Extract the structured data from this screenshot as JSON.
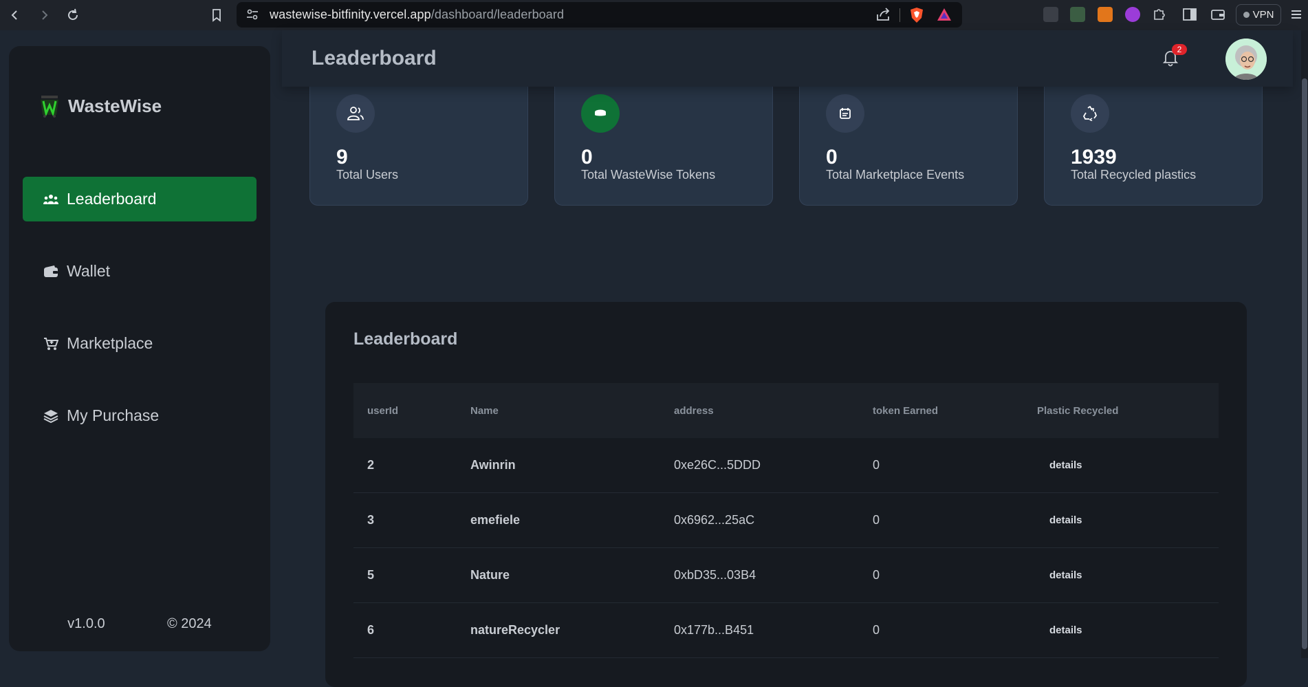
{
  "browser": {
    "url_host": "wastewise-bitfinity.vercel.app",
    "url_path": "/dashboard/leaderboard",
    "vpn_label": "VPN"
  },
  "app": {
    "brand_name": "WasteWise",
    "page_title": "Leaderboard",
    "notification_count": "2",
    "sidebar": {
      "items": [
        {
          "label": "Leaderboard",
          "icon": "users-icon",
          "active": true
        },
        {
          "label": "Wallet",
          "icon": "wallet-icon",
          "active": false
        },
        {
          "label": "Marketplace",
          "icon": "cart-icon",
          "active": false
        },
        {
          "label": "My Purchase",
          "icon": "layers-icon",
          "active": false
        }
      ],
      "version": "v1.0.0",
      "copyright": "© 2024"
    },
    "stats": [
      {
        "value": "9",
        "label": "Total Users",
        "icon": "users-outline-icon"
      },
      {
        "value": "0",
        "label": "Total WasteWise Tokens",
        "icon": "coins-icon"
      },
      {
        "value": "0",
        "label": "Total Marketplace Events",
        "icon": "calendar-icon"
      },
      {
        "value": "1939",
        "label": "Total Recycled plastics",
        "icon": "recycle-icon"
      }
    ],
    "leaderboard": {
      "title": "Leaderboard",
      "columns": [
        "userId",
        "Name",
        "address",
        "token Earned",
        "Plastic Recycled"
      ],
      "rows": [
        {
          "userId": "2",
          "name": "Awinrin",
          "address": "0xe26C...5DDD",
          "tokens": "0",
          "action": "details"
        },
        {
          "userId": "3",
          "name": "emefiele",
          "address": "0x6962...25aC",
          "tokens": "0",
          "action": "details"
        },
        {
          "userId": "5",
          "name": "Nature",
          "address": "0xbD35...03B4",
          "tokens": "0",
          "action": "details"
        },
        {
          "userId": "6",
          "name": "natureRecycler",
          "address": "0x177b...B451",
          "tokens": "0",
          "action": "details"
        }
      ]
    }
  }
}
